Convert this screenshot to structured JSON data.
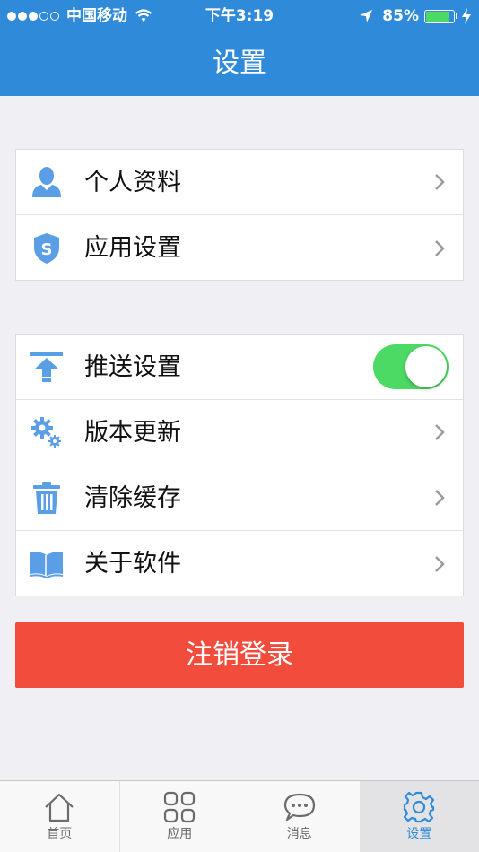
{
  "status_bar": {
    "carrier": "中国移动",
    "time": "下午3:19",
    "battery": "85%",
    "battery_level": 0.85,
    "signal_bars_on": 3,
    "signal_bars_total": 5
  },
  "header": {
    "title": "设置"
  },
  "groups": [
    {
      "items": [
        {
          "label": "个人资料",
          "icon": "user-icon",
          "control": "chevron"
        },
        {
          "label": "应用设置",
          "icon": "shield-s-icon",
          "control": "chevron"
        }
      ]
    },
    {
      "items": [
        {
          "label": "推送设置",
          "icon": "push-upload-icon",
          "control": "toggle",
          "toggle_on": true
        },
        {
          "label": "版本更新",
          "icon": "gears-icon",
          "control": "chevron"
        },
        {
          "label": "清除缓存",
          "icon": "trash-icon",
          "control": "chevron"
        },
        {
          "label": "关于软件",
          "icon": "book-icon",
          "control": "chevron"
        }
      ]
    }
  ],
  "logout_label": "注销登录",
  "tabbar": {
    "tabs": [
      {
        "label": "首页",
        "icon": "home-icon",
        "active": false
      },
      {
        "label": "应用",
        "icon": "apps-grid-icon",
        "active": false
      },
      {
        "label": "消息",
        "icon": "message-bubble-icon",
        "active": false
      },
      {
        "label": "设置",
        "icon": "gear-icon",
        "active": true
      }
    ]
  },
  "colors": {
    "header_bg": "#2f8ad9",
    "icon_blue": "#5a9ee6",
    "toggle_on": "#4cd964",
    "logout_bg": "#f24c3d",
    "tab_active": "#2f8ad9",
    "page_bg": "#efeff4"
  }
}
